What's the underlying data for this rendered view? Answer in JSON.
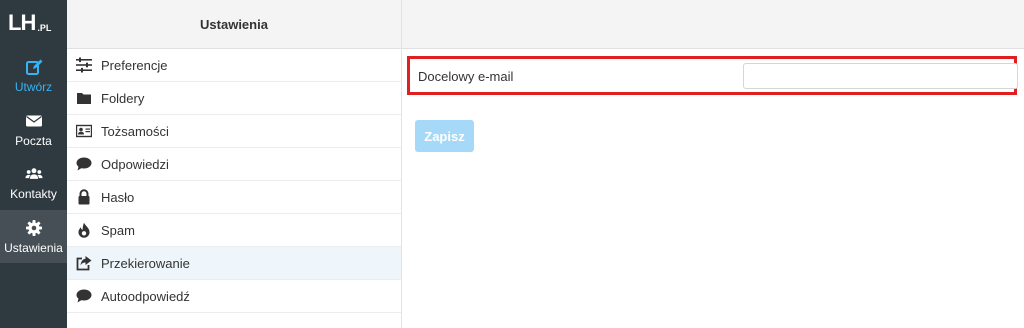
{
  "logo": {
    "main": "LH",
    "suffix": ".PL"
  },
  "nav": [
    {
      "label": "Utwórz",
      "icon": "compose-icon"
    },
    {
      "label": "Poczta",
      "icon": "envelope-icon"
    },
    {
      "label": "Kontakty",
      "icon": "users-icon"
    },
    {
      "label": "Ustawienia",
      "icon": "gear-icon"
    }
  ],
  "settings": {
    "title": "Ustawienia",
    "items": [
      {
        "label": "Preferencje",
        "icon": "sliders-icon"
      },
      {
        "label": "Foldery",
        "icon": "folder-icon"
      },
      {
        "label": "Tożsamości",
        "icon": "id-card-icon"
      },
      {
        "label": "Odpowiedzi",
        "icon": "comment-icon"
      },
      {
        "label": "Hasło",
        "icon": "lock-icon"
      },
      {
        "label": "Spam",
        "icon": "fire-icon"
      },
      {
        "label": "Przekierowanie",
        "icon": "forward-icon"
      },
      {
        "label": "Autoodpowiedź",
        "icon": "comment-icon"
      }
    ],
    "selected": "Przekierowanie"
  },
  "form": {
    "label": "Docelowy e-mail",
    "value": "",
    "save_label": "Zapisz"
  },
  "colors": {
    "accent": "#37b2f2",
    "highlight_border": "#e02020",
    "nav_bg": "#2f3a40"
  }
}
